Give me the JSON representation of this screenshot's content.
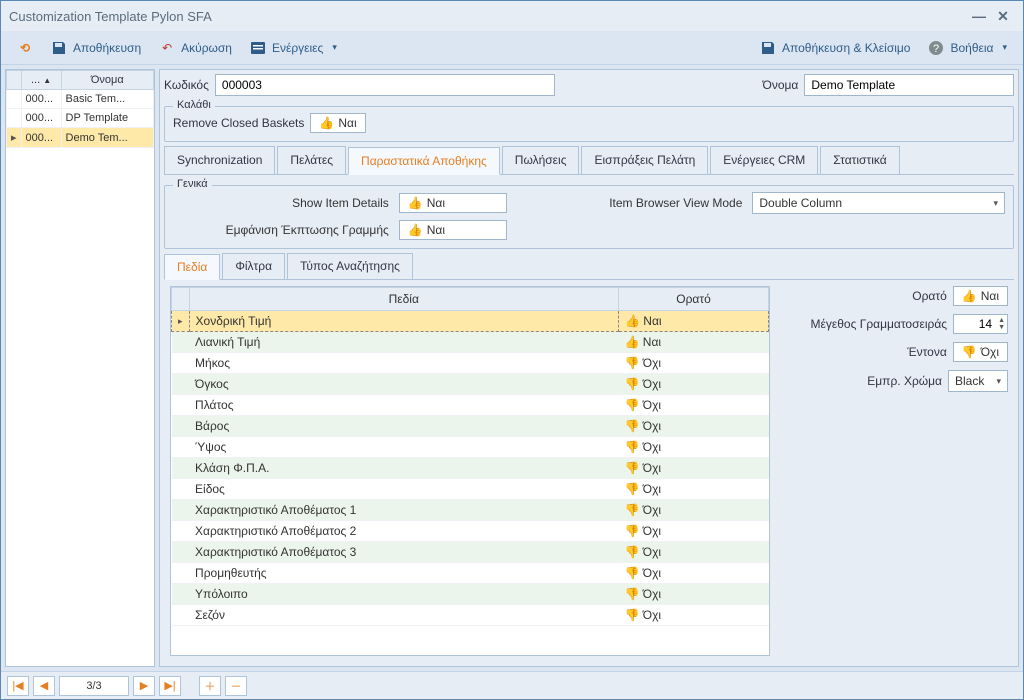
{
  "window": {
    "title": "Customization Template Pylon SFA"
  },
  "toolbar": {
    "save": "Αποθήκευση",
    "cancel": "Ακύρωση",
    "actions": "Ενέργειες",
    "save_close": "Αποθήκευση & Κλείσιμο",
    "help": "Βοήθεια"
  },
  "sidebar": {
    "cols": {
      "id": "...",
      "name": "Όνομα"
    },
    "rows": [
      {
        "id": "000...",
        "name": "Basic Tem..."
      },
      {
        "id": "000...",
        "name": "DP Template"
      },
      {
        "id": "000...",
        "name": "Demo Tem..."
      }
    ],
    "selected_index": 2
  },
  "header": {
    "code_label": "Κωδικός",
    "code_value": "000003",
    "name_label": "Όνομα",
    "name_value": "Demo Template"
  },
  "basket": {
    "legend": "Καλάθι",
    "remove_label": "Remove Closed Baskets",
    "remove_value": "Ναι"
  },
  "tabs": [
    "Synchronization",
    "Πελάτες",
    "Παραστατικά Αποθήκης",
    "Πωλήσεις",
    "Εισπράξεις Πελάτη",
    "Ενέργειες CRM",
    "Στατιστικά"
  ],
  "active_tab": 2,
  "general": {
    "legend": "Γενικά",
    "show_item_details": {
      "label": "Show Item Details",
      "value": "Ναι"
    },
    "browser_mode": {
      "label": "Item Browser View Mode",
      "value": "Double Column"
    },
    "line_discount": {
      "label": "Εμφάνιση Έκπτωσης Γραμμής",
      "value": "Ναι"
    }
  },
  "subtabs": [
    "Πεδία",
    "Φίλτρα",
    "Τύπος Αναζήτησης"
  ],
  "active_subtab": 0,
  "fields_table": {
    "cols": {
      "field": "Πεδία",
      "visible": "Ορατό"
    },
    "rows": [
      {
        "f": "Χονδρική Τιμή",
        "v": "Ναι",
        "up": true
      },
      {
        "f": "Λιανική Τιμή",
        "v": "Ναι",
        "up": true
      },
      {
        "f": "Μήκος",
        "v": "Όχι",
        "up": false
      },
      {
        "f": "Όγκος",
        "v": "Όχι",
        "up": false
      },
      {
        "f": "Πλάτος",
        "v": "Όχι",
        "up": false
      },
      {
        "f": "Βάρος",
        "v": "Όχι",
        "up": false
      },
      {
        "f": "Ύψος",
        "v": "Όχι",
        "up": false
      },
      {
        "f": "Κλάση Φ.Π.Α.",
        "v": "Όχι",
        "up": false
      },
      {
        "f": "Είδος",
        "v": "Όχι",
        "up": false
      },
      {
        "f": "Χαρακτηριστικό Αποθέματος 1",
        "v": "Όχι",
        "up": false
      },
      {
        "f": "Χαρακτηριστικό Αποθέματος 2",
        "v": "Όχι",
        "up": false
      },
      {
        "f": "Χαρακτηριστικό Αποθέματος 3",
        "v": "Όχι",
        "up": false
      },
      {
        "f": "Προμηθευτής",
        "v": "Όχι",
        "up": false
      },
      {
        "f": "Υπόλοιπο",
        "v": "Όχι",
        "up": false
      },
      {
        "f": "Σεζόν",
        "v": "Όχι",
        "up": false
      }
    ],
    "selected_index": 0
  },
  "props": {
    "visible": {
      "label": "Ορατό",
      "value": "Ναι",
      "up": true
    },
    "fontsize": {
      "label": "Μέγεθος Γραμματοσειράς",
      "value": "14"
    },
    "bold": {
      "label": "Έντονα",
      "value": "Όχι",
      "up": false
    },
    "fgcolor": {
      "label": "Εμπρ. Χρώμα",
      "value": "Black"
    }
  },
  "footer": {
    "page": "3/3"
  }
}
